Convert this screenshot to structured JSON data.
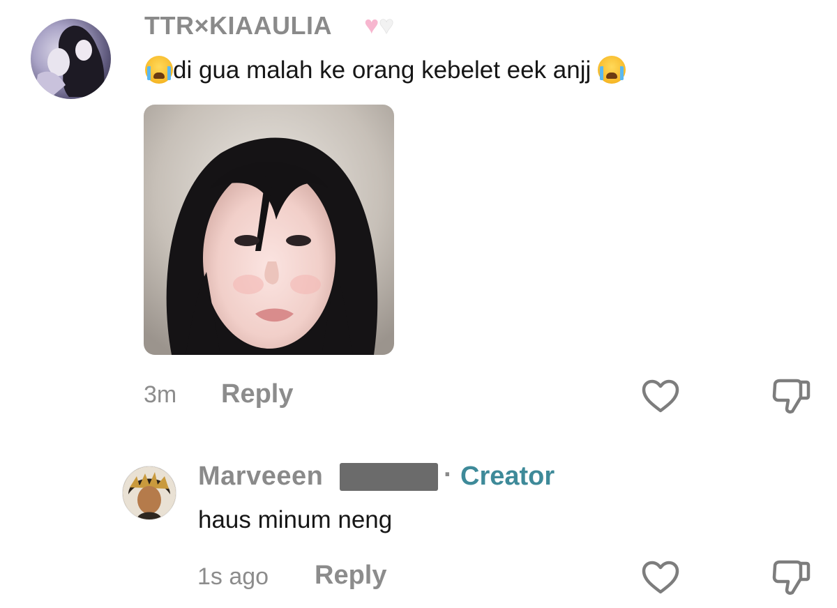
{
  "comments": [
    {
      "username": "TTR×KIAAULIA",
      "badge_hearts": [
        "🩷",
        "🤍"
      ],
      "text": "di gua malah ke orang kebelet eek anjj",
      "emoji": "loudly-crying-face",
      "has_image": true,
      "time": "3m",
      "reply_label": "Reply",
      "avatar_icon": "anime-avatar",
      "like_icon": "heart-outline-icon",
      "dislike_icon": "thumbs-down-outline-icon"
    },
    {
      "username": "Marveeen",
      "creator_separator": "·",
      "creator_label": "Creator",
      "text": "haus minum neng",
      "time": "1s ago",
      "reply_label": "Reply",
      "avatar_icon": "anime-avatar",
      "like_icon": "heart-outline-icon",
      "dislike_icon": "thumbs-down-outline-icon"
    }
  ],
  "colors": {
    "username": "#8a8a8a",
    "creator": "#3e8a99",
    "meta": "#8c8c8c",
    "text": "#161616",
    "icon_stroke": "#7d7d7d"
  }
}
